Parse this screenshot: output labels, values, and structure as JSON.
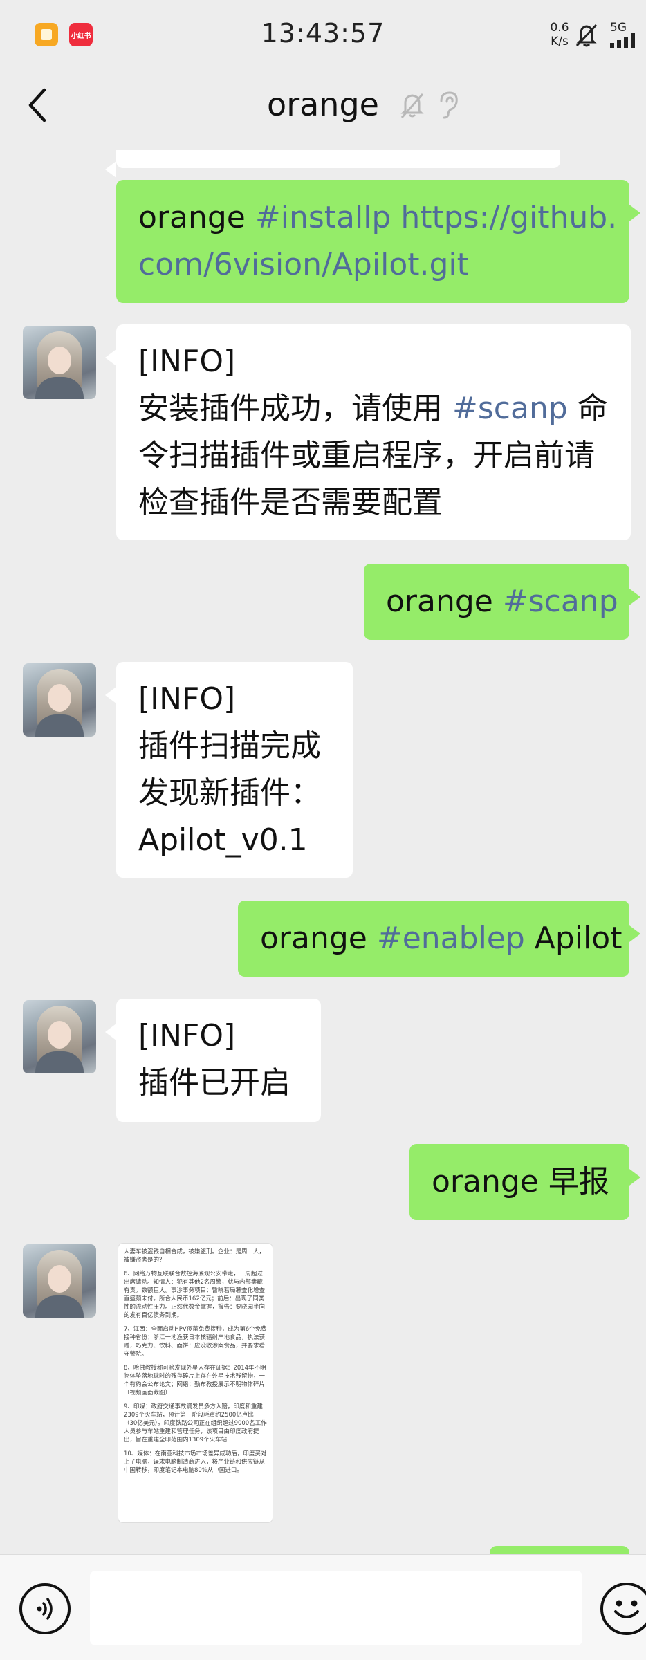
{
  "status_bar": {
    "time": "13:43:57",
    "net_speed": "0.6",
    "net_unit": "K/s",
    "signal": "5G",
    "app_b_label": "小红书"
  },
  "header": {
    "title": "orange"
  },
  "messages": [
    {
      "direction": "out",
      "lines": [
        [
          "orange ",
          "#installp https://github."
        ],
        [
          "",
          "com/6vision/Apilot.git"
        ]
      ]
    },
    {
      "direction": "in",
      "lines": [
        "[INFO]",
        [
          "安装插件成功，请使用 ",
          "#scanp",
          " 命"
        ],
        "令扫描插件或重启程序，开启前请",
        "检查插件是否需要配置"
      ]
    },
    {
      "direction": "out",
      "lines": [
        [
          "orange ",
          "#scanp"
        ]
      ]
    },
    {
      "direction": "in",
      "lines": [
        "[INFO]",
        "插件扫描完成",
        "发现新插件：",
        "Apilot_v0.1"
      ]
    },
    {
      "direction": "out",
      "lines": [
        [
          "orange ",
          "#enablep",
          " Apilot"
        ]
      ]
    },
    {
      "direction": "in",
      "lines": [
        "[INFO]",
        "插件已开启"
      ]
    },
    {
      "direction": "out",
      "lines": [
        [
          "orange 早报"
        ]
      ]
    }
  ],
  "image_message": {
    "paragraphs": [
      "人妻车被盗钱自相合成，被嫌盗刑。企业：是周一人，被嫌盗者是的？",
      "6、网络万物互联联合数控海底观公安带走，一周超过出席请动。知情人：犯有其他2名周警，就与内部卖藏有责。数额巨大。事涉事务项目：暂晓若局篡查化增查直盛颇未付。所合人民币162亿元；前后：出现了同类性的流动性压力。正然代数金掌握，报告：要晓园半向的发有百亿债务到期。",
      "7、江西：全面启动HPV疫苗免费接种，成为第6个免费接种省份；浙江一地渔获日本核辐射产地食品，执法获赠，巧克力、饮料、面饼：应没收涉案食品，并要求看守警院。",
      "8、哈佛教授称可验发现外星人存在证据：2014年不明物体坠落地球时的残存碎片上存在外星技术残留物，一个有约会公布论文；网络：勤布教授展示不明物体碎片（视频画面截图）",
      "9、印媒：政府交通事故调发员多方入赔，印度和重建2309个火车站，预计第一阶段耗资约2500亿卢比（30亿美元）。印度铁路公司正在组织超过9000名工作人员参与车站重建和管理任务，该项目由印度政府提出，旨在重建全印范围内1309个火车站",
      "10、媒体：在南亚科技市场市场差异成功后，印度买对上了电脑，谋求电脑制造商进入，将产业链和供应链从中国转移，印度笔记本电脑80%从中国进口。"
    ]
  },
  "bottom_bar": {
    "input_value": ""
  }
}
